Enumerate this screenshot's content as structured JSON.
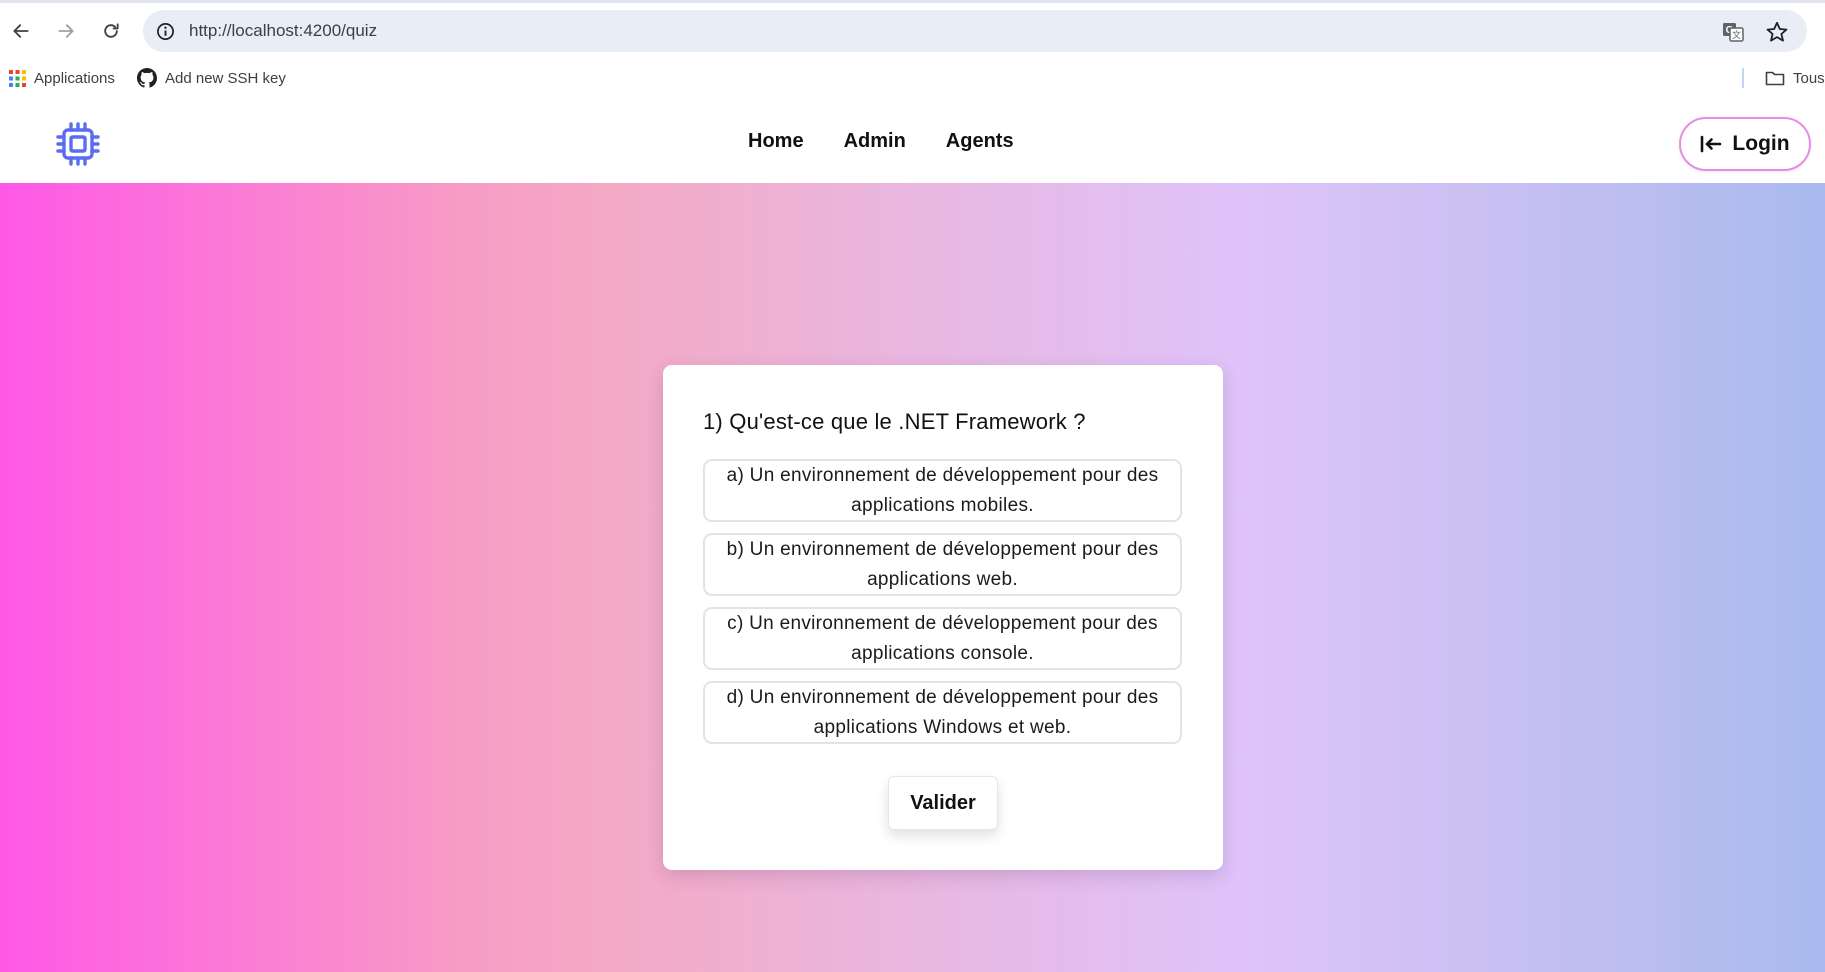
{
  "browser": {
    "url": "http://localhost:4200/quiz",
    "bookmarks": [
      {
        "label": "Applications",
        "icon": "apps-grid-icon"
      },
      {
        "label": "Add new SSH key",
        "icon": "github-icon"
      }
    ],
    "all_bookmarks_label": "Tous"
  },
  "navbar": {
    "logo_icon": "cpu-chip-icon",
    "links": [
      "Home",
      "Admin",
      "Agents"
    ],
    "login_label": "Login",
    "login_icon": "login-arrow-icon",
    "accent_color": "#5b6cf2"
  },
  "quiz": {
    "question": "1) Qu'est-ce que le .NET Framework ?",
    "options": [
      "a) Un environnement de développement pour des applications mobiles.",
      "b) Un environnement de développement pour des applications web.",
      "c) Un environnement de développement pour des applications console.",
      "d) Un environnement de développement pour des applications Windows et web."
    ],
    "submit_label": "Valider"
  },
  "colors": {
    "gradient": [
      "#ff58e6",
      "#f4a9c4",
      "#dfc3fa",
      "#a9baee"
    ],
    "login_border": "#e88be8"
  }
}
